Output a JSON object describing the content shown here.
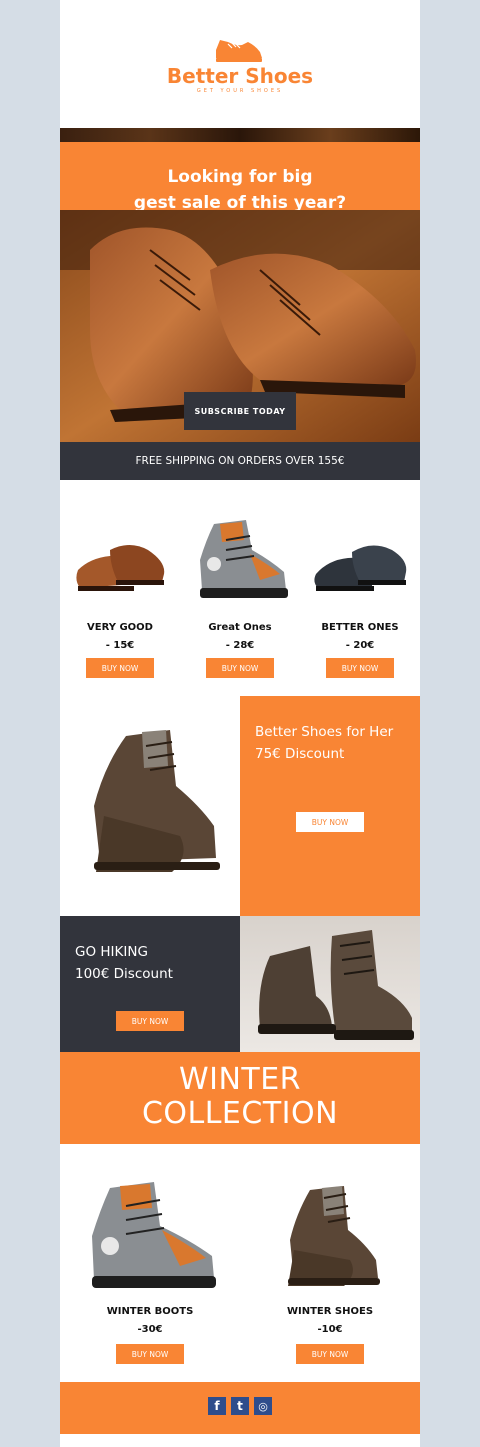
{
  "brand": {
    "name": "Better Shoes",
    "tagline": "GET YOUR SHOES",
    "color": "#f98534"
  },
  "hero": {
    "title_line1": "Looking for big",
    "title_line2": "gest sale of this year?",
    "cta": "SUBSCRIBE TODAY"
  },
  "shipping": "FREE SHIPPING ON ORDERS OVER 155€",
  "products": [
    {
      "name": "VERY GOOD",
      "price": "- 15€",
      "cta": "BUY NOW",
      "icon": "brown-oxford-shoe-icon"
    },
    {
      "name": "Great Ones",
      "price": "- 28€",
      "cta": "BUY NOW",
      "icon": "hiking-boot-icon"
    },
    {
      "name": "BETTER ONES",
      "price": "- 20€",
      "cta": "BUY NOW",
      "icon": "black-loafer-icon"
    }
  ],
  "promo_her": {
    "line1": "Better Shoes for Her",
    "line2": "75€ Discount",
    "cta": "BUY NOW"
  },
  "promo_hiking": {
    "line1": "GO HIKING",
    "line2": "100€ Discount",
    "cta": "BUY NOW"
  },
  "winter": {
    "line1": "WINTER",
    "line2": "COLLECTION"
  },
  "winter_products": [
    {
      "name": "WINTER BOOTS",
      "price": "-30€",
      "cta": "BUY NOW"
    },
    {
      "name": "WINTER SHOES",
      "price": "-10€",
      "cta": "BUY NOW"
    }
  ],
  "social": [
    {
      "label": "f",
      "icon": "facebook-icon"
    },
    {
      "label": "t",
      "icon": "tumblr-icon"
    },
    {
      "label": "◎",
      "icon": "instagram-icon"
    }
  ]
}
